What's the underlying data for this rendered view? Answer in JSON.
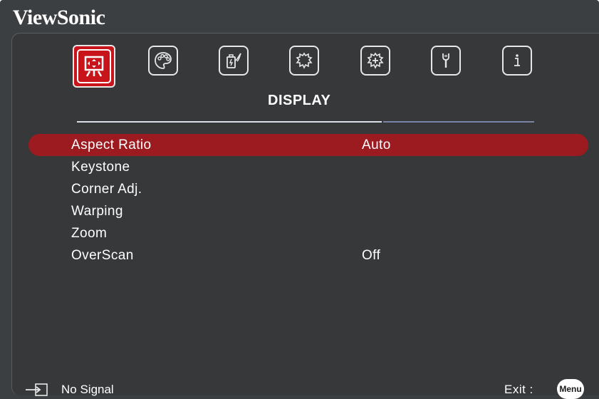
{
  "brand": {
    "name": "ViewSonic"
  },
  "colors": {
    "panel_bg": "#36383a",
    "accent_red": "#c8151b",
    "selection_red": "#9c1b20",
    "text": "#ffffff"
  },
  "tabs": [
    {
      "icon": "display-icon",
      "active": true
    },
    {
      "icon": "palette-icon",
      "active": false
    },
    {
      "icon": "power-management-icon",
      "active": false
    },
    {
      "icon": "basic-settings-icon",
      "active": false
    },
    {
      "icon": "advanced-settings-icon",
      "active": false
    },
    {
      "icon": "system-tools-icon",
      "active": false
    },
    {
      "icon": "information-icon",
      "active": false
    }
  ],
  "section_title": "DISPLAY",
  "menu": {
    "items": [
      {
        "label": "Aspect Ratio",
        "value": "Auto",
        "selected": true
      },
      {
        "label": "Keystone",
        "value": ""
      },
      {
        "label": "Corner Adj.",
        "value": ""
      },
      {
        "label": "Warping",
        "value": ""
      },
      {
        "label": "Zoom",
        "value": ""
      },
      {
        "label": "OverScan",
        "value": "Off"
      }
    ]
  },
  "footer": {
    "input_icon": "input-source-icon",
    "status": "No Signal",
    "exit_label": "Exit :",
    "menu_button": "Menu"
  }
}
